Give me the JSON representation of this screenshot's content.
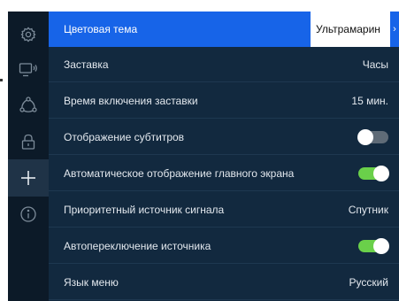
{
  "colors": {
    "sidebar_bg": "#0c1a28",
    "panel_bg": "#12293f",
    "selected_row": "#1764e8",
    "toggle_on": "#6ad04a",
    "toggle_off": "#5f6b77"
  },
  "sidebar": {
    "items": [
      {
        "icon": "gear-icon"
      },
      {
        "icon": "tv-signal-icon"
      },
      {
        "icon": "network-nodes-icon"
      },
      {
        "icon": "lock-icon"
      },
      {
        "icon": "plus-icon",
        "active": true
      },
      {
        "icon": "info-icon"
      }
    ]
  },
  "settings": {
    "rows": [
      {
        "label": "Цветовая тема",
        "value": "Ультрамарин",
        "chevron": "›"
      },
      {
        "label": "Заставка",
        "value": "Часы"
      },
      {
        "label": "Время включения заставки",
        "value": "15 мин."
      },
      {
        "label": "Отображение субтитров",
        "toggle": "off"
      },
      {
        "label": "Автоматическое отображение главного экрана",
        "toggle": "on"
      },
      {
        "label": "Приоритетный источник сигнала",
        "value": "Спутник"
      },
      {
        "label": "Автопереключение источника",
        "toggle": "on"
      },
      {
        "label": "Язык меню",
        "value": "Русский"
      }
    ]
  }
}
